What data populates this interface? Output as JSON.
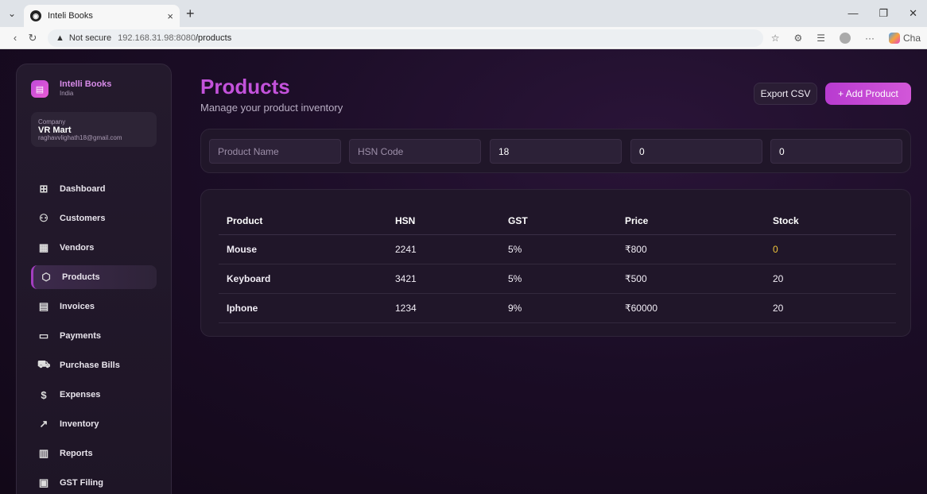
{
  "browser": {
    "tab_title": "Inteli Books",
    "tab_close": "×",
    "new_tab": "+",
    "not_secure": "Not secure",
    "url_host": "192.168.31.98:8080",
    "url_path": "/products",
    "copilot_label": "Cha"
  },
  "sidebar": {
    "brand_name": "Intelli Books",
    "brand_sub": "India",
    "company_label": "Company",
    "company_name": "VR Mart",
    "company_email": "raghavvlighath18@gmail.com",
    "items": [
      {
        "label": "Dashboard",
        "icon": "grid-icon"
      },
      {
        "label": "Customers",
        "icon": "users-icon"
      },
      {
        "label": "Vendors",
        "icon": "building-icon"
      },
      {
        "label": "Products",
        "icon": "box-icon"
      },
      {
        "label": "Invoices",
        "icon": "file-icon"
      },
      {
        "label": "Payments",
        "icon": "card-icon"
      },
      {
        "label": "Purchase Bills",
        "icon": "cart-icon"
      },
      {
        "label": "Expenses",
        "icon": "dollar-icon"
      },
      {
        "label": "Inventory",
        "icon": "trend-icon"
      },
      {
        "label": "Reports",
        "icon": "chart-icon"
      },
      {
        "label": "GST Filing",
        "icon": "doc-icon"
      }
    ],
    "active": "Products"
  },
  "header": {
    "title": "Products",
    "subtitle": "Manage your product inventory",
    "export_label": "Export CSV",
    "add_label": "+ Add Product"
  },
  "form": {
    "product_name_placeholder": "Product Name",
    "hsn_placeholder": "HSN Code",
    "gst_value": "18",
    "price_value": "0",
    "stock_value": "0"
  },
  "table": {
    "headers": [
      "Product",
      "HSN",
      "GST",
      "Price",
      "Stock"
    ],
    "rows": [
      {
        "product": "Mouse",
        "hsn": "2241",
        "gst": "5%",
        "price": "₹800",
        "stock": "0"
      },
      {
        "product": "Keyboard",
        "hsn": "3421",
        "gst": "5%",
        "price": "₹500",
        "stock": "20"
      },
      {
        "product": "Iphone",
        "hsn": "1234",
        "gst": "9%",
        "price": "₹60000",
        "stock": "20"
      }
    ]
  },
  "colors": {
    "accent": "#c352db",
    "low_stock": "#f0c63b"
  }
}
